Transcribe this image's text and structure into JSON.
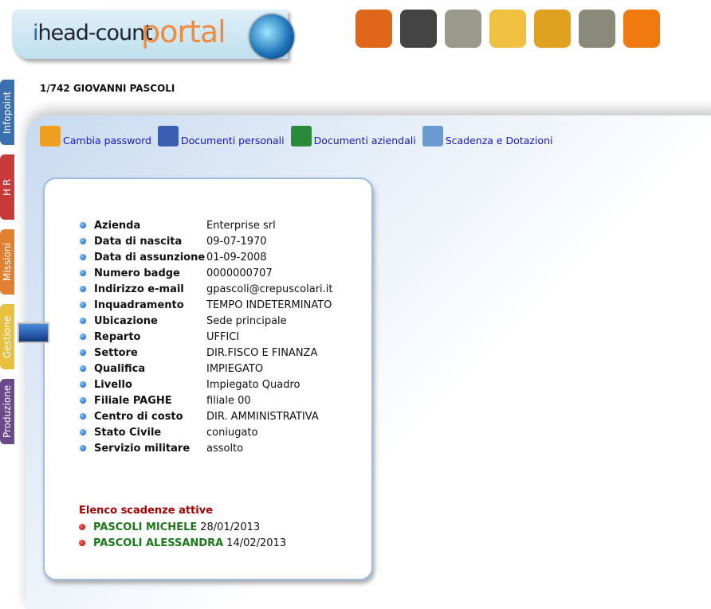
{
  "logo": {
    "text_head": "head-count",
    "text_portal": "portal"
  },
  "toolbar": {
    "icons": [
      "home-icon",
      "user-icon",
      "folder-add-icon",
      "pie-chart-icon",
      "calendar-icon",
      "folder-check-icon",
      "power-icon"
    ],
    "colors": [
      "#e0661a",
      "#444",
      "#9a9a8a",
      "#f0c040",
      "#e0a020",
      "#8a8a7a",
      "#f07a10"
    ]
  },
  "employee_title": "1/742 GIOVANNI PASCOLI",
  "sidebar": [
    {
      "label": "Infopoint",
      "color": "#3a6fb0"
    },
    {
      "label": "H R",
      "color": "#c83a3a"
    },
    {
      "label": "Missioni",
      "color": "#e08030"
    },
    {
      "label": "Gestione",
      "color": "#e8c040"
    },
    {
      "label": "Produzione",
      "color": "#6a4a8a"
    }
  ],
  "links": [
    {
      "label": "Cambia password",
      "icon": "key-icon",
      "color": "#f0a020"
    },
    {
      "label": "Documenti personali",
      "icon": "word-doc-icon",
      "color": "#3a5fb0"
    },
    {
      "label": "Documenti aziendali",
      "icon": "excel-doc-icon",
      "color": "#2a8a3a"
    },
    {
      "label": "Scadenza e Dotazioni",
      "icon": "clock-calendar-icon",
      "color": "#6a9ad0"
    }
  ],
  "details": [
    {
      "label": "Azienda",
      "value": "Enterprise srl"
    },
    {
      "label": "Data di nascita",
      "value": "09-07-1970"
    },
    {
      "label": "Data di assunzione",
      "value": "01-09-2008"
    },
    {
      "label": "Numero badge",
      "value": "0000000707"
    },
    {
      "label": "Indirizzo e-mail",
      "value": "gpascoli@crepuscolari.it"
    },
    {
      "label": "Inquadramento",
      "value": "TEMPO INDETERMINATO"
    },
    {
      "label": "Ubicazione",
      "value": "Sede principale"
    },
    {
      "label": "Reparto",
      "value": "UFFICI"
    },
    {
      "label": "Settore",
      "value": "DIR.FISCO E FINANZA"
    },
    {
      "label": "Qualifica",
      "value": "IMPIEGATO"
    },
    {
      "label": "Livello",
      "value": "Impiegato Quadro"
    },
    {
      "label": "Filiale PAGHE",
      "value": "filiale 00"
    },
    {
      "label": "Centro di costo",
      "value": "DIR. AMMINISTRATIVA"
    },
    {
      "label": "Stato Civile",
      "value": "coniugato"
    },
    {
      "label": "Servizio militare",
      "value": "assolto"
    }
  ],
  "deadlines": {
    "title": "Elenco scadenze attive",
    "items": [
      {
        "name": "PASCOLI MICHELE",
        "date": "28/01/2013"
      },
      {
        "name": "PASCOLI ALESSANDRA",
        "date": "14/02/2013"
      }
    ]
  }
}
